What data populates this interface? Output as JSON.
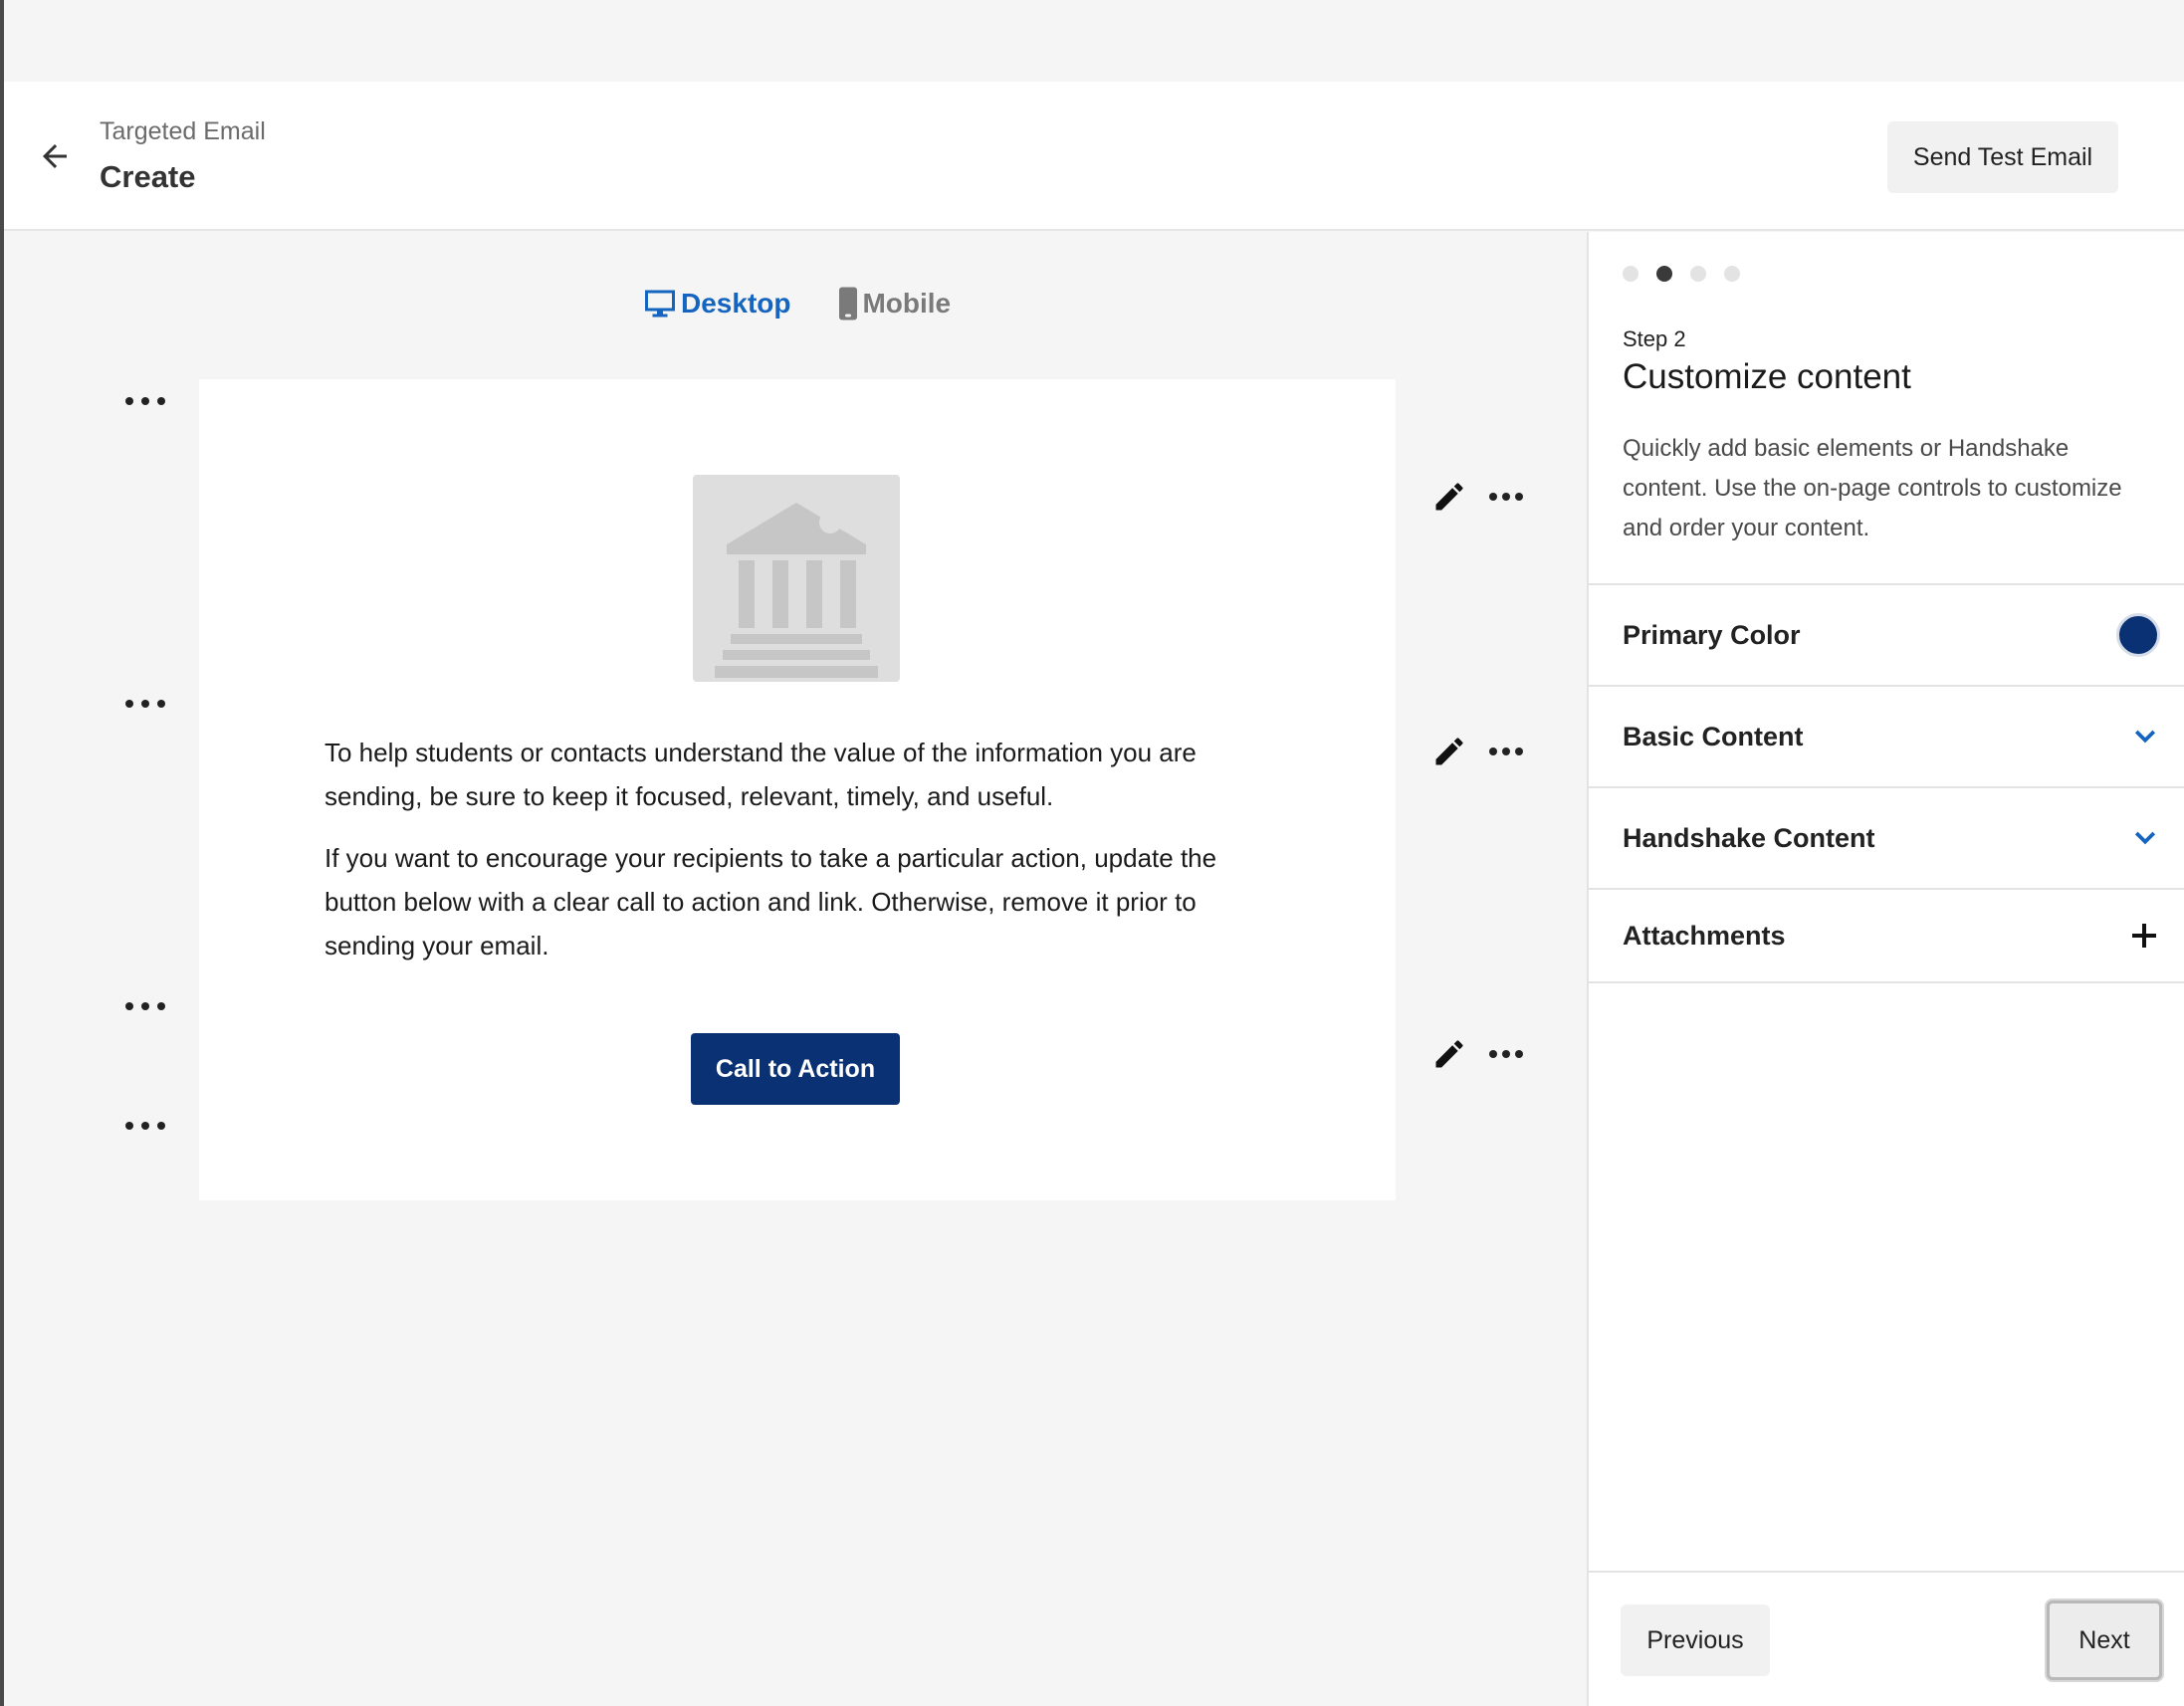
{
  "header": {
    "subtitle": "Targeted Email",
    "title": "Create",
    "send_test_label": "Send Test Email"
  },
  "preview": {
    "views": [
      {
        "label": "Desktop",
        "icon": "desktop-icon",
        "active": true
      },
      {
        "label": "Mobile",
        "icon": "mobile-icon",
        "active": false
      }
    ]
  },
  "email": {
    "paragraph_1": "To help students or contacts understand the value of the information you are sending, be sure to keep it focused, relevant, timely, and useful.",
    "paragraph_2": "If you want to encourage your recipients to take a particular action, update the button below with a clear call to action and link. Otherwise, remove it prior to sending your email.",
    "cta_label": "Call to Action",
    "logo_icon": "institution-icon"
  },
  "panel": {
    "step_total": 4,
    "step_current": 2,
    "step_label": "Step 2",
    "title": "Customize content",
    "description": "Quickly add basic elements or Handshake content. Use the on-page controls to customize and order your content.",
    "sections": [
      {
        "label": "Primary Color",
        "control": "color-swatch",
        "color": "#0a3174"
      },
      {
        "label": "Basic Content",
        "control": "chevron-down-icon"
      },
      {
        "label": "Handshake Content",
        "control": "chevron-down-icon"
      },
      {
        "label": "Attachments",
        "control": "plus-icon"
      }
    ],
    "previous_label": "Previous",
    "next_label": "Next"
  },
  "colors": {
    "accent": "#1565c0",
    "primary": "#0a3174",
    "background": "#f5f5f5"
  }
}
